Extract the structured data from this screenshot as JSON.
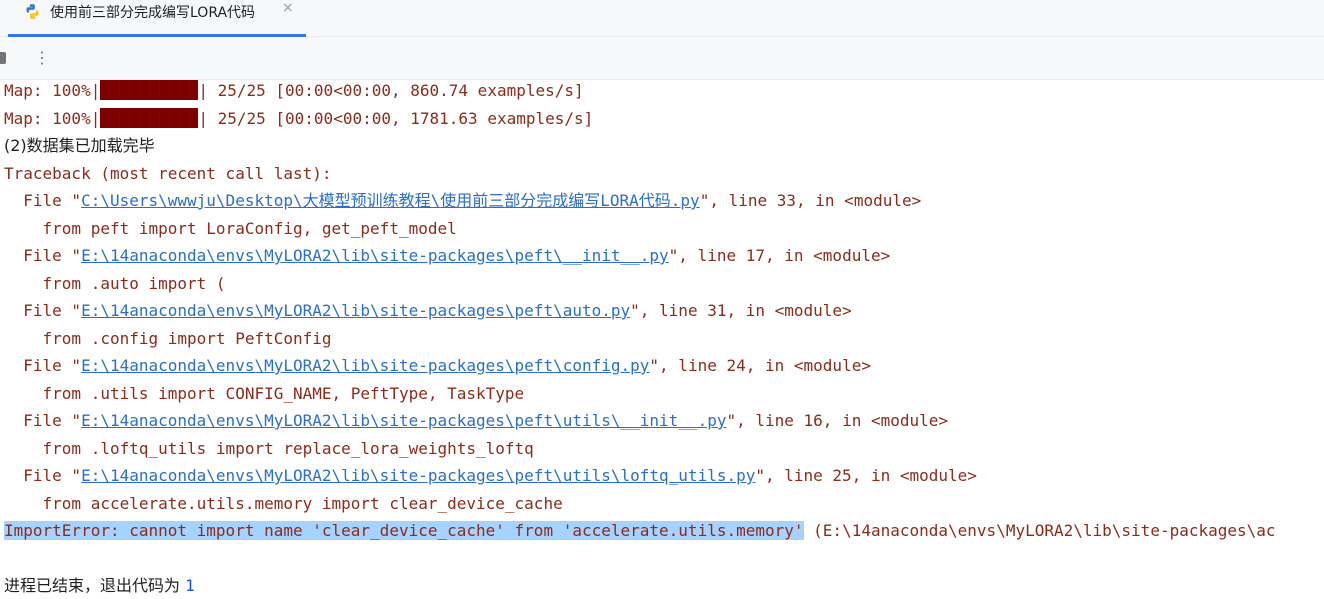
{
  "tab": {
    "title": "使用前三部分完成编写LORA代码",
    "close": "×"
  },
  "toolbar": {
    "more": "⋮"
  },
  "console": {
    "map1": {
      "prefix": "Map: 100%|",
      "suffix": "| 25/25 [00:00<00:00, 860.74 examples/s]"
    },
    "map2": {
      "prefix": "Map: 100%|",
      "suffix": "| 25/25 [00:00<00:00, 1781.63 examples/s]"
    },
    "loaded": "(2)数据集已加载完毕",
    "traceback": "Traceback (most recent call last):",
    "frames": [
      {
        "pre": "  File \"",
        "path": "C:\\Users\\wwwju\\Desktop\\大模型预训练教程\\使用前三部分完成编写LORA代码.py",
        "post": "\", line 33, in <module>",
        "code": "    from peft import LoraConfig, get_peft_model"
      },
      {
        "pre": "  File \"",
        "path": "E:\\14anaconda\\envs\\MyLORA2\\lib\\site-packages\\peft\\__init__.py",
        "post": "\", line 17, in <module>",
        "code": "    from .auto import ("
      },
      {
        "pre": "  File \"",
        "path": "E:\\14anaconda\\envs\\MyLORA2\\lib\\site-packages\\peft\\auto.py",
        "post": "\", line 31, in <module>",
        "code": "    from .config import PeftConfig"
      },
      {
        "pre": "  File \"",
        "path": "E:\\14anaconda\\envs\\MyLORA2\\lib\\site-packages\\peft\\config.py",
        "post": "\", line 24, in <module>",
        "code": "    from .utils import CONFIG_NAME, PeftType, TaskType"
      },
      {
        "pre": "  File \"",
        "path": "E:\\14anaconda\\envs\\MyLORA2\\lib\\site-packages\\peft\\utils\\__init__.py",
        "post": "\", line 16, in <module>",
        "code": "    from .loftq_utils import replace_lora_weights_loftq"
      },
      {
        "pre": "  File \"",
        "path": "E:\\14anaconda\\envs\\MyLORA2\\lib\\site-packages\\peft\\utils\\loftq_utils.py",
        "post": "\", line 25, in <module>",
        "code": "    from accelerate.utils.memory import clear_device_cache"
      }
    ],
    "error_selected": "ImportError: cannot import name 'clear_device_cache' from 'accelerate.utils.memory'",
    "error_rest": " (E:\\14anaconda\\envs\\MyLORA2\\lib\\site-packages\\ac",
    "exit_text": "进程已结束，退出代码为 ",
    "exit_code": "1"
  },
  "colors": {
    "error_text": "#8c2b1c",
    "link": "#2a6fcb",
    "selection": "#a6d2ff",
    "progress_bar": "#7d0000",
    "tab_accent": "#3574f0"
  }
}
